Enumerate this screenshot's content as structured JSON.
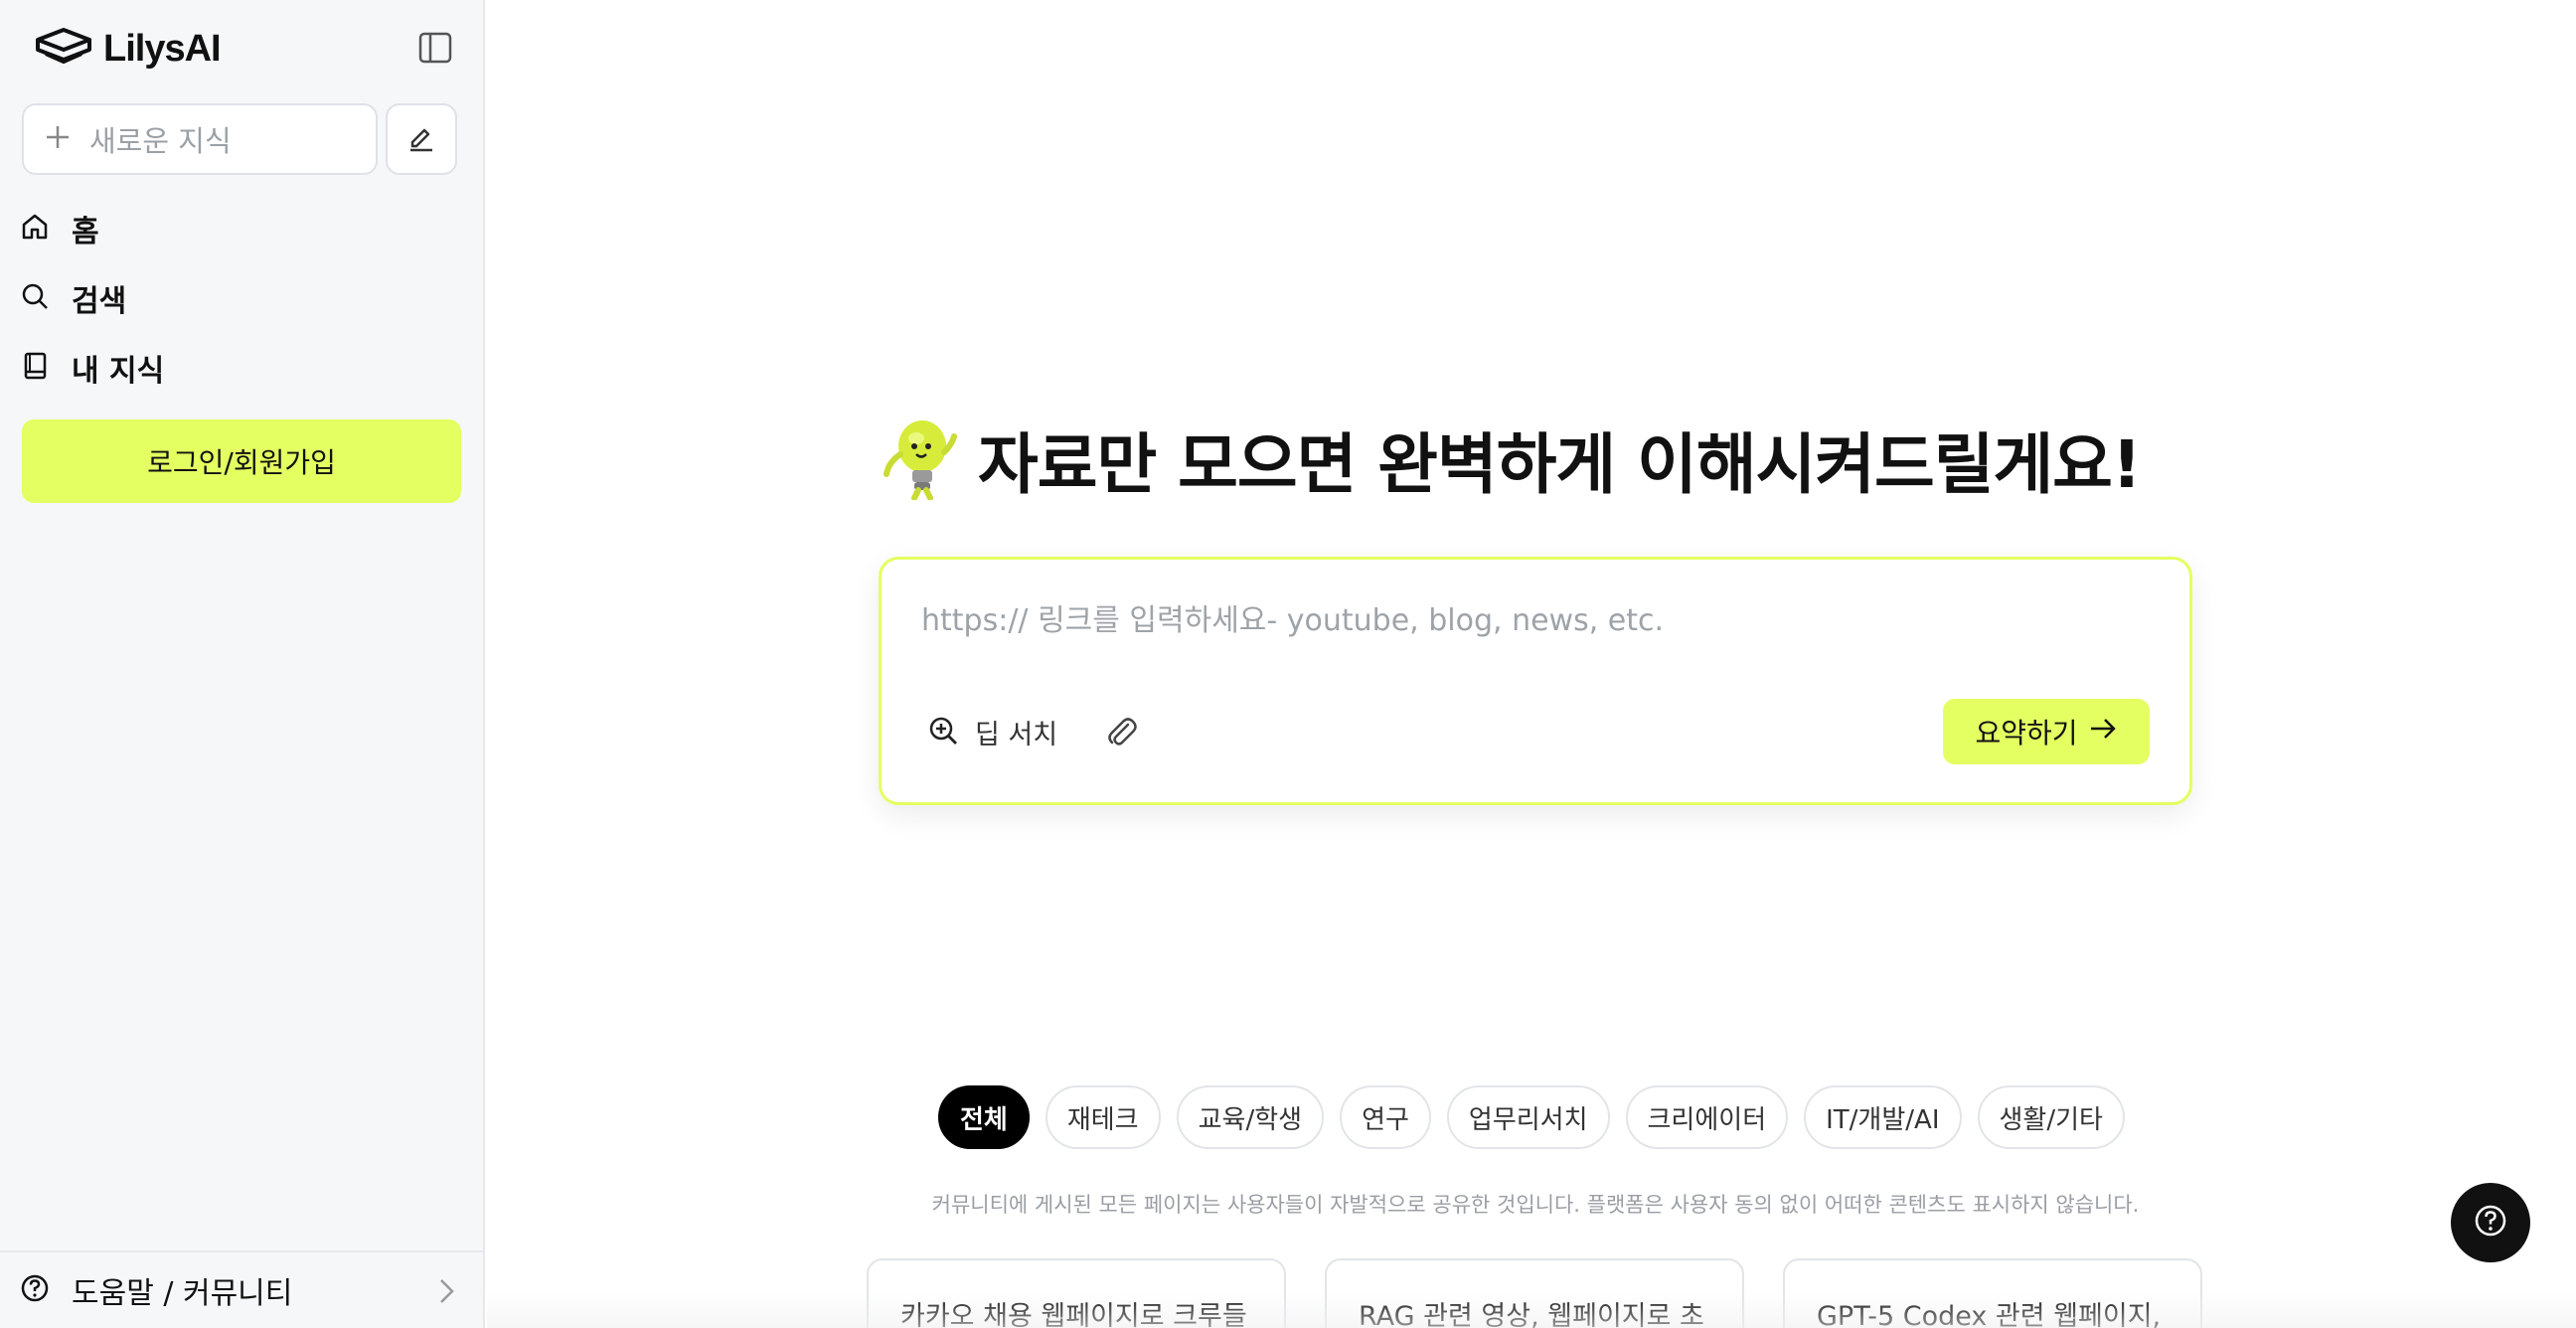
{
  "sidebar": {
    "logo_text": "LilysAI",
    "new_button_label": "새로운 지식",
    "nav": [
      {
        "label": "홈",
        "icon": "home-icon"
      },
      {
        "label": "검색",
        "icon": "search-icon"
      },
      {
        "label": "내 지식",
        "icon": "book-icon"
      }
    ],
    "login_label": "로그인/회원가입",
    "help_label": "도움말 / 커뮤니티"
  },
  "main": {
    "headline": "자료만 모으면 완벽하게 이해시켜드릴게요!",
    "mascot_icon": "lightbulb-mascot-icon",
    "input_placeholder": "https:// 링크를 입력하세요- youtube, blog, news, etc.",
    "deep_search_label": "딥 서치",
    "summarize_label": "요약하기",
    "categories": [
      "전체",
      "재테크",
      "교육/학생",
      "연구",
      "업무리서치",
      "크리에이터",
      "IT/개발/AI",
      "생활/기타"
    ],
    "active_category": "전체",
    "disclaimer": "커뮤니티에 게시된 모든 페이지는 사용자들이 자발적으로 공유한 것입니다. 플랫폼은 사용자 동의 없이 어떠한 콘텐츠도 표시하지 않습니다.",
    "cards": [
      {
        "title": "카카오 채용 웹페이지로 크루들"
      },
      {
        "title": "RAG 관련 영상, 웹페이지로 초"
      },
      {
        "title": "GPT-5 Codex 관련 웹페이지,"
      }
    ]
  },
  "colors": {
    "accent": "#e4ff61",
    "sidebar_bg": "#f6f7f9",
    "active_chip": "#000000"
  }
}
